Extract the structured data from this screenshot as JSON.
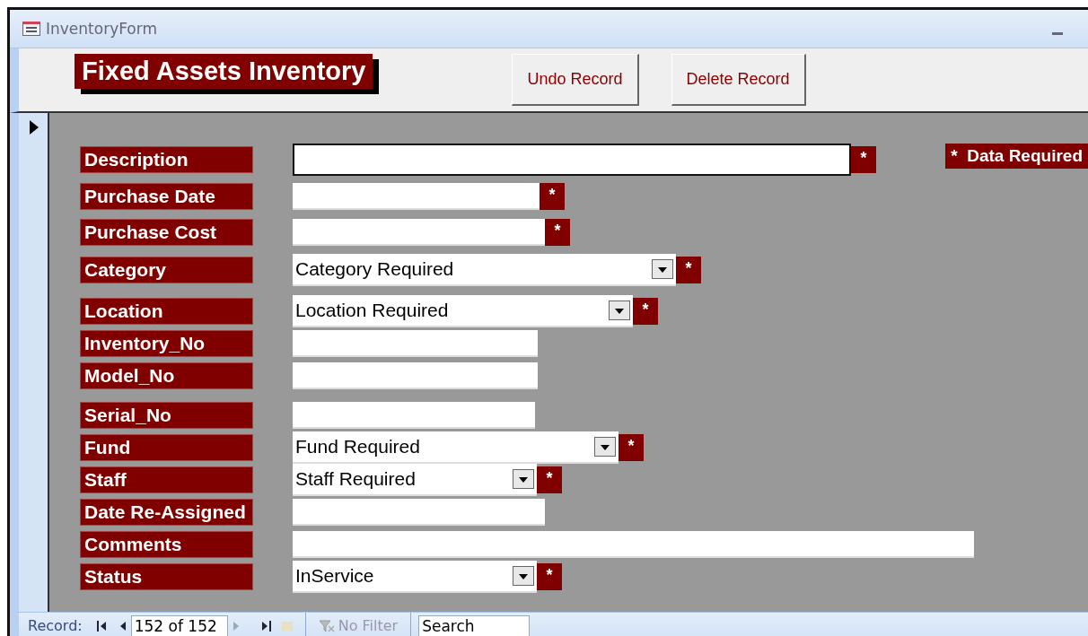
{
  "window": {
    "title": "InventoryForm"
  },
  "header": {
    "title": "Fixed Assets Inventory",
    "buttons": [
      "Undo Record",
      "Delete Record"
    ]
  },
  "legend": {
    "marker": "*",
    "text": "Data Required"
  },
  "fields": [
    {
      "label": "Description",
      "kind": "text",
      "marker": "*",
      "focused": true
    },
    {
      "label": "Purchase Date",
      "kind": "text",
      "marker": "*",
      "focused": false
    },
    {
      "label": "Purchase Cost",
      "kind": "text",
      "marker": "*",
      "focused": false
    },
    {
      "label": "Category",
      "kind": "combo",
      "value": "Category Required",
      "marker": "*"
    },
    {
      "label": "Location",
      "kind": "combo",
      "value": "Location Required",
      "marker": "*"
    },
    {
      "label": "Inventory_No",
      "kind": "text",
      "focused": false
    },
    {
      "label": "Model_No",
      "kind": "text",
      "focused": false
    },
    {
      "label": "Serial_No",
      "kind": "text",
      "focused": false
    },
    {
      "label": "Fund",
      "kind": "combo",
      "value": "Fund Required",
      "marker": "*"
    },
    {
      "label": "Staff",
      "kind": "combo",
      "value": "Staff Required",
      "marker": "*"
    },
    {
      "label": "Date Re-Assigned",
      "kind": "text",
      "focused": false
    },
    {
      "label": "Comments",
      "kind": "text",
      "focused": false
    },
    {
      "label": "Status",
      "kind": "combo",
      "value": "InService",
      "marker": "*"
    }
  ],
  "navigation": {
    "label": "Record:",
    "position": "152 of 152",
    "filter": "No Filter",
    "search": {
      "placeholder": "Search"
    }
  }
}
